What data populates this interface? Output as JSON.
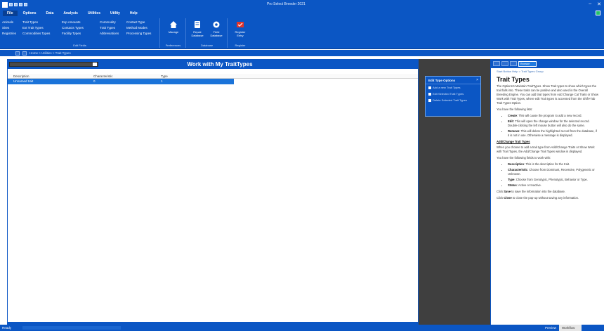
{
  "titlebar": {
    "title": "Pro Select Breeder 2021",
    "minimize": "–",
    "close": "✕"
  },
  "menu": {
    "tabs": [
      "File",
      "Options",
      "Data",
      "Analysis",
      "Utilities",
      "Utility",
      "Help"
    ],
    "active_index": 0
  },
  "ribbon": {
    "groups": [
      {
        "cols": [
          [
            "Animals",
            "Sires",
            "Registries"
          ],
          [
            "Trait Types",
            "Ext Trait Types",
            "Commodities Types"
          ],
          [
            "Exp Amounts",
            "Contacts Types",
            "Facility Types"
          ],
          [
            "Commodity",
            "Trait Types",
            "Abbreviations"
          ],
          [
            "Contact Type",
            "Method Modes",
            "Processing Types"
          ]
        ],
        "caption": "Edit Fields"
      },
      {
        "buttons": [
          {
            "label": "Manage",
            "icon": "house-icon"
          }
        ],
        "caption": "Preferences"
      },
      {
        "buttons": [
          {
            "label": "Repair Database",
            "icon": "database-icon"
          },
          {
            "label": "Field Database",
            "icon": "gear-icon"
          }
        ],
        "caption": "Database"
      },
      {
        "buttons": [
          {
            "label": "Register Entry",
            "icon": "register-icon"
          }
        ],
        "caption": "Register"
      }
    ]
  },
  "nav": {
    "breadcrumb": "Home > Utilities > Trait Types"
  },
  "main": {
    "title": "Work with My TraitTypes",
    "columns": [
      "Description",
      "Characteristic",
      "Type"
    ],
    "rows": [
      {
        "description": "Unnamed trait",
        "characteristic": "0",
        "type": "1"
      }
    ]
  },
  "edit_options": {
    "header": "Edit Type Options",
    "close": "×",
    "items": [
      "Add a new Trait Types",
      "Edit Selected Trait Types",
      "Delete Selected Trait Types"
    ]
  },
  "help": {
    "selector": "Browse",
    "breadcrumb": "Start Button Help > Trait Types Group",
    "title": "Trait Types",
    "intro": "The Options's Maintain TraitTypes. Show Trait types to show which types the trait falls into. These traits can be positive and also used in the Overall Breeding Engine. You can add trait types from Add Change Cat Traits or Show Work with Trait Types, where edit Trait types is accessed from the Shift+Tab Trait Types Option.",
    "buttons_intro": "You have the following lists:",
    "buttons": [
      {
        "name": "Create",
        "text": "This will cause the program to add a new record."
      },
      {
        "name": "Edit",
        "text": "This will open the change window for the selected record. Double-clicking the left mouse button will also do the same."
      },
      {
        "name": "Remove",
        "text": "This will delete the highlighted record from the database, if it is not in use. Otherwise a message is displayed."
      }
    ],
    "subhead": "Add/Change Trait Types",
    "sub_intro": "When you choose to add a trait type from Add/Change Traits or Show Work with Trait Types, the Add/Change Trait Types window is displayed.",
    "fields_intro": "You have the following fields to work with:",
    "fields": [
      {
        "name": "Description",
        "text": "This is the description for the trait."
      },
      {
        "name": "Characteristic",
        "text": "Choose from Dominant, Recessive, Polygenetic or Unknown."
      },
      {
        "name": "Type",
        "text": "Choose from Genotypic, Phenotypic, Behavior or Type."
      },
      {
        "name": "Status",
        "text": "Active or Inactive."
      }
    ],
    "save_note_pre": "Click ",
    "save_word": "Save",
    "save_note_post": " to save the information into the database.",
    "close_note_pre": "Click ",
    "close_word": "Close",
    "close_note_post": " to close the pop-up without saving any information."
  },
  "status": {
    "label": "Ready",
    "tabs": [
      "Preview",
      "Workflow"
    ]
  },
  "colors": {
    "brand_blue": "#0b56c4",
    "selection_blue": "#1a73d9",
    "dark_panel": "#3f3f3f",
    "register_red": "#e0342a"
  }
}
